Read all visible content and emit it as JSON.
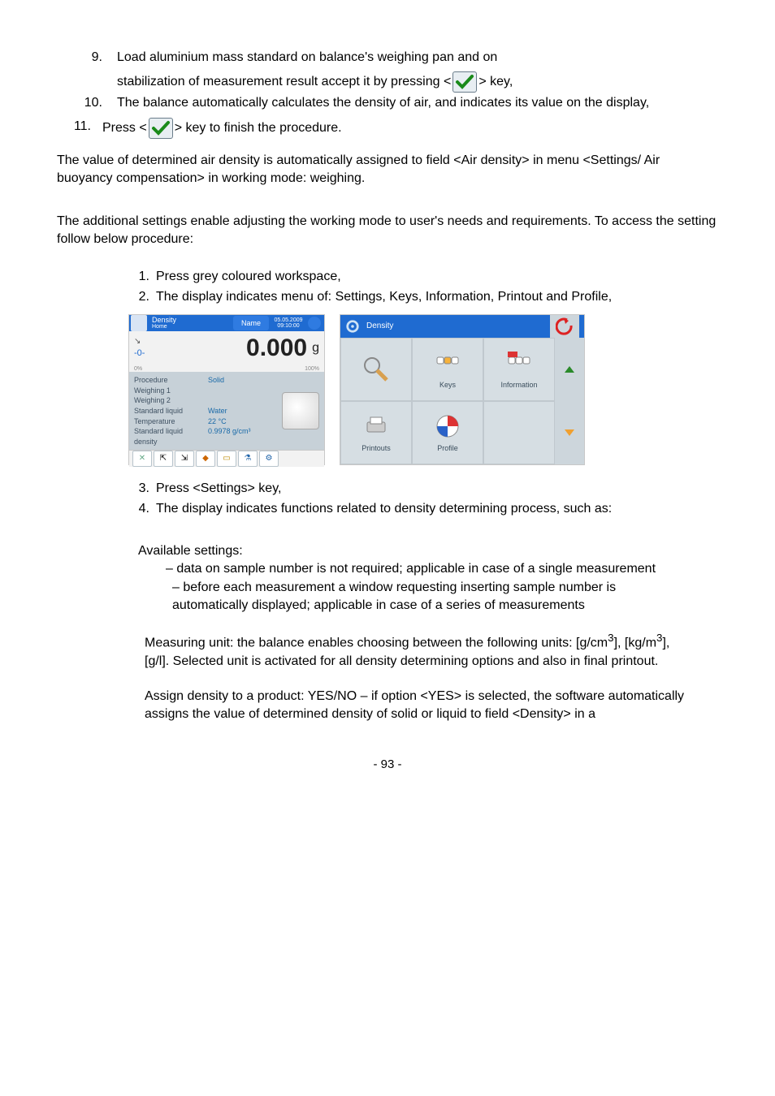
{
  "step9": {
    "num": "9.",
    "line1": "Load aluminium mass standard on balance's weighing pan and on",
    "line2a": "stabilization of measurement result accept it by pressing <",
    "line2b": "> key,"
  },
  "step10": {
    "num": "10.",
    "text": "The balance automatically calculates the density of air, and indicates its value on the display,"
  },
  "step11": {
    "num": "11.",
    "a": "Press <",
    "b": "> key to finish the procedure."
  },
  "para1": "The value of determined air density is automatically assigned to field <Air density> in menu <Settings/ Air buoyancy compensation> in working mode: weighing.",
  "para2": "The additional settings enable adjusting the working mode to user's needs and requirements. To access the setting follow below procedure:",
  "inner1": {
    "num": "1.",
    "text": "Press grey coloured workspace,"
  },
  "inner2": {
    "num": "2.",
    "text": "The display indicates menu of: Settings, Keys, Information, Printout and Profile,"
  },
  "inner3": {
    "num": "3.",
    "text": "Press <Settings> key,"
  },
  "inner4": {
    "num": "4.",
    "text": "The display indicates functions related to density determining process, such as:"
  },
  "avail": "Available settings:",
  "no_line": "– data on sample number is not required; applicable in case of a single measurement",
  "yes_line": "– before each measurement a window requesting inserting sample number is automatically displayed; applicable in case of a series of measurements",
  "unit_a": "Measuring unit: the balance enables choosing between the following units: [g/cm",
  "unit_b": "], [kg/m",
  "unit_c": "], [g/l]. Selected unit is activated for all density determining options and also in final printout.",
  "assign": "Assign density to a product: YES/NO – if option <YES> is selected, the software automatically assigns the value of determined density of solid or liquid to field <Density> in a",
  "pagenum": "- 93 -",
  "screen1": {
    "title1": "Density",
    "title2": "Home",
    "name": "Name",
    "date": "05.05.2009",
    "time": "09:10:00",
    "zero": "-0-",
    "zeropct": "0%",
    "reading": "0.000",
    "unit": "g",
    "hundred": "100%",
    "labels": {
      "l1": "Procedure",
      "l2": "Weighing 1",
      "l3": "Weighing 2",
      "l4": "Standard liquid",
      "l5": "Temperature",
      "l6": "Standard liquid density"
    },
    "vals": {
      "v1": "Solid",
      "v4": "Water",
      "v5": "22 °C",
      "v6": "0.9978 g/cm³"
    }
  },
  "screen2": {
    "title": "Density",
    "cells": {
      "keys": "Keys",
      "info": "Information",
      "print": "Printouts",
      "profile": "Profile"
    }
  }
}
